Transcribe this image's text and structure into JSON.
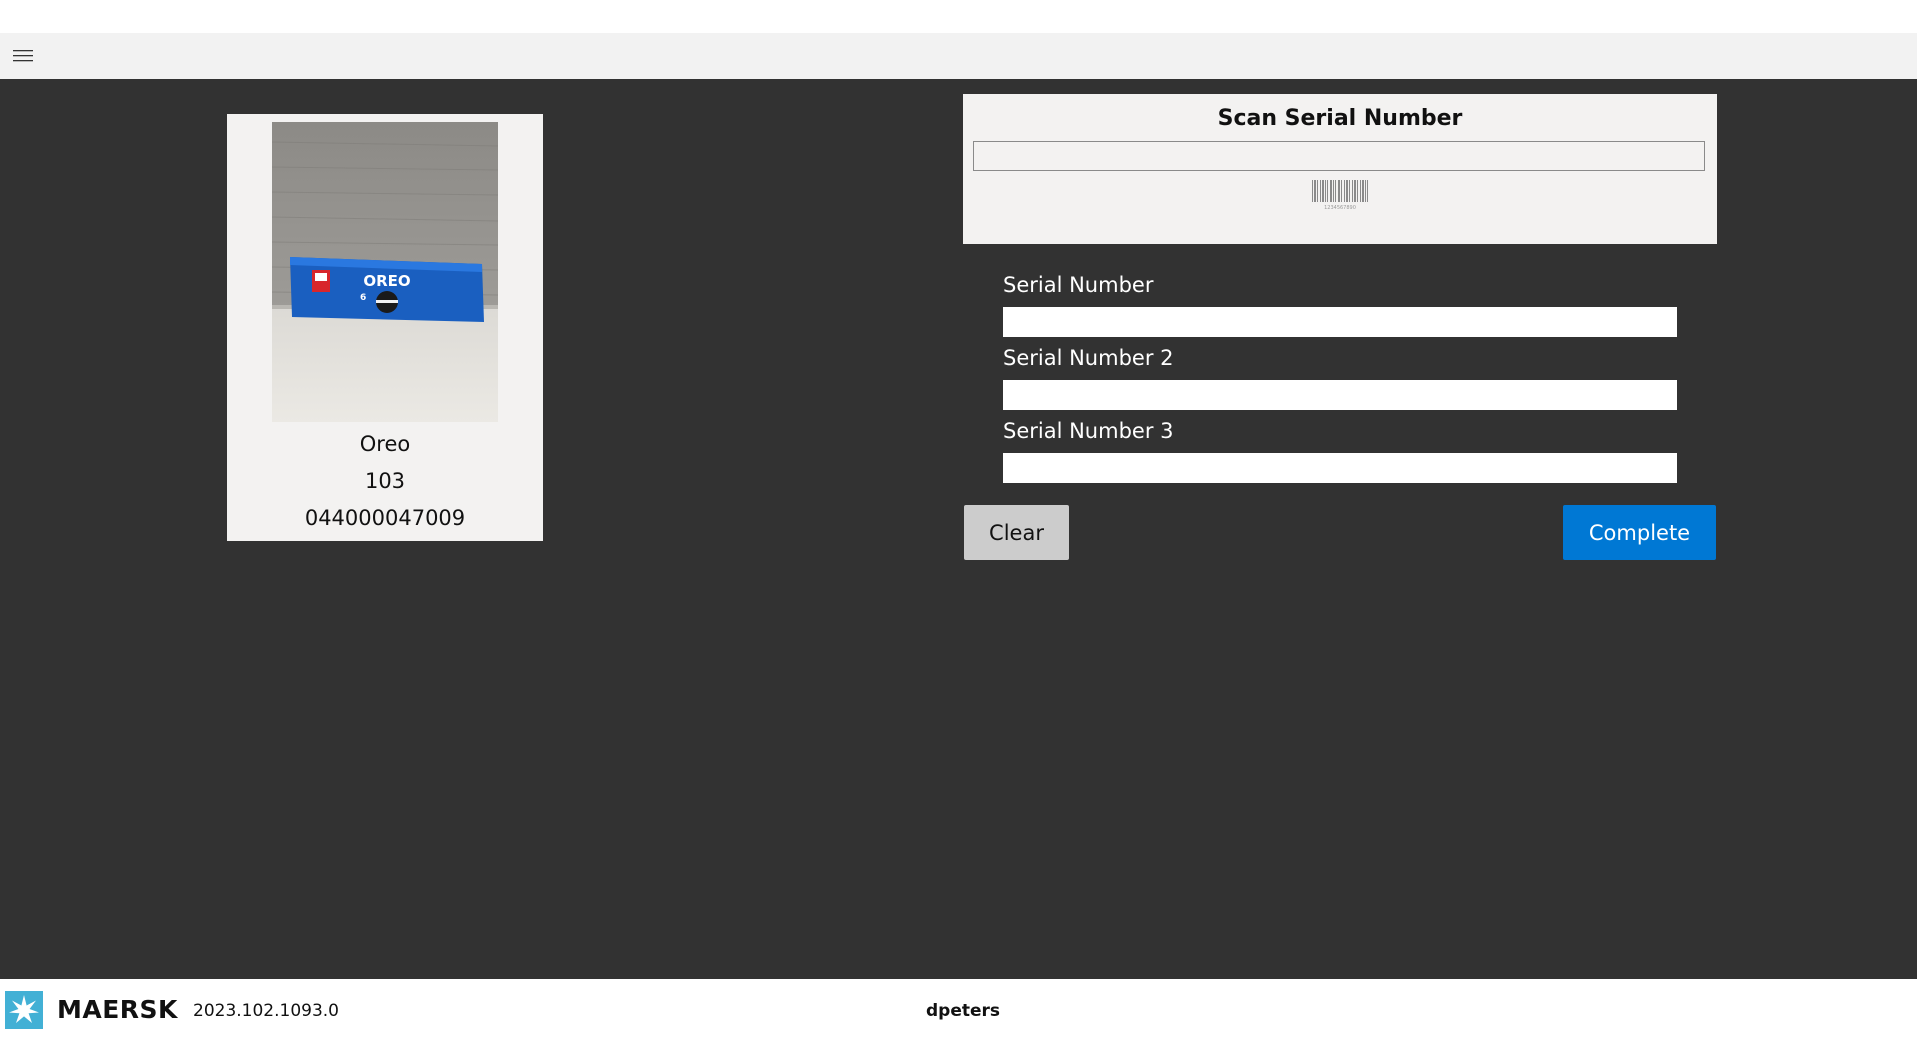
{
  "menu": {
    "icon": "hamburger-icon"
  },
  "product_card": {
    "image_icon": "oreo-package-photo",
    "name": "Oreo",
    "number": "103",
    "upc": "044000047009"
  },
  "scan": {
    "title": "Scan Serial Number",
    "input_value": "",
    "barcode_icon": "barcode-icon",
    "barcode_text": "1234567890"
  },
  "fields": [
    {
      "label": "Serial Number",
      "value": ""
    },
    {
      "label": "Serial Number 2",
      "value": ""
    },
    {
      "label": "Serial Number 3",
      "value": ""
    }
  ],
  "actions": {
    "clear_label": "Clear",
    "complete_label": "Complete"
  },
  "footer": {
    "logo_icon": "maersk-star-logo",
    "brand": "MAERSK",
    "version": "2023.102.1093.0",
    "username": "dpeters"
  },
  "colors": {
    "primary": "#0078d4",
    "background": "#323232",
    "panel": "#f3f2f1",
    "logo": "#42b0d5"
  }
}
